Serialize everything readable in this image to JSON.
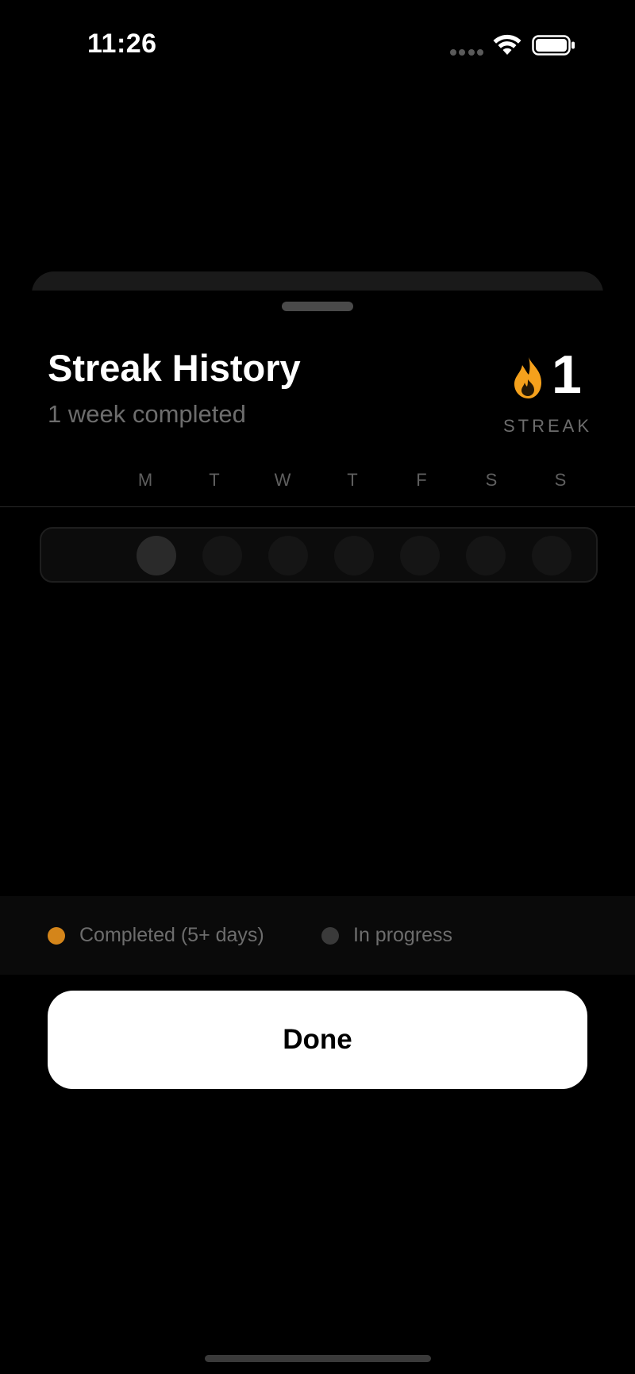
{
  "status_bar": {
    "time": "11:26"
  },
  "sheet": {
    "title": "Streak History",
    "subtitle": "1 week completed",
    "streak": {
      "count": "1",
      "label": "STREAK",
      "icon": "flame-icon",
      "accent": "#F5A11C"
    },
    "days": [
      "M",
      "T",
      "W",
      "T",
      "F",
      "S",
      "S"
    ],
    "weeks": [
      {
        "days": [
          "current",
          "empty",
          "empty",
          "empty",
          "empty",
          "empty",
          "empty"
        ]
      }
    ],
    "legend": [
      {
        "label": "Completed (5+ days)",
        "color": "#D4851A"
      },
      {
        "label": "In progress",
        "color": "#3A3A3A"
      }
    ],
    "done_label": "Done"
  }
}
